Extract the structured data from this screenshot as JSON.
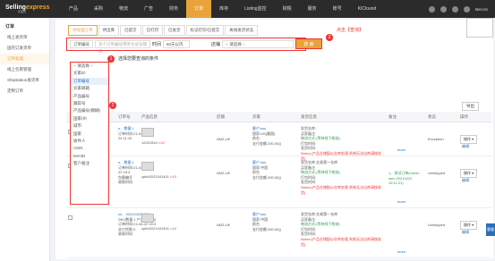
{
  "brand": {
    "name_a": "Selling",
    "name_b": "express",
    "sub": "赛盈网"
  },
  "nav": [
    "产品",
    "采购",
    "物流",
    "广告",
    "财务",
    "订单",
    "库存",
    "Listing监控",
    "财税",
    "服务",
    "账号",
    "KIClound"
  ],
  "nav_active": 5,
  "sidebar": {
    "section": "订单",
    "items": [
      "线上发货单",
      "国内订发货单",
      "订单处理",
      "线上包裹管理",
      "Shipstation发货单",
      "定制订单"
    ],
    "active": 2
  },
  "tabs": [
    "待处理订单",
    "待出库",
    "已提交",
    "已打印",
    "已发货",
    "标记打印/已提交",
    "离线发货状态"
  ],
  "filter": {
    "type": "订单编号",
    "placeholder": "多个订单编号用英文逗号隔开",
    "time_label": "时间",
    "time_value": "60天以内",
    "sort_label": "店铺",
    "store_placeholder": "-- 请选择 --"
  },
  "search_button": "搜 索",
  "badge1": "1",
  "badge2": "2",
  "badge3": "3",
  "note_query": "点击【查询】",
  "note_select": "选择您要查询的条件",
  "dropdown": [
    "-- 请选择 --",
    "买家ID",
    "订单编号",
    "买家邮箱",
    "产品编号",
    "跟踪号",
    "产品编号(模糊)",
    "国家/州",
    "城市",
    "国家",
    "收件人",
    "ASIN",
    "ItemID",
    "客户备注"
  ],
  "dropdown_active": 2,
  "export": "导出",
  "table_headers": [
    "订单号",
    "产品信息",
    "店铺",
    "买家",
    "发货信息",
    "备注",
    "状态",
    "操作"
  ],
  "rows": [
    {
      "order": [
        "s... 数量 1",
        "订单时间:21-04",
        "24 11:10"
      ],
      "sku": "12221544",
      "qty": "×10",
      "store": "AMZ-UK",
      "buyer": [
        "客户:sss",
        "国家:US(美国)",
        "前台",
        "支付金额:200.00()"
      ],
      "ship": [
        "发货仓库:",
        "买家备注:",
        "物流方式:(等待线下物流)",
        "打包时间:",
        "发货时间:"
      ],
      "notes": "Notes:(产品仓储配以仓库处理,系统无法出库请按发货)",
      "remark": "",
      "status": "Exception",
      "op": "操作"
    },
    {
      "order": [
        "s... 数量 1",
        "订单时间:21-04-",
        "22 15:3",
        "包裹编号",
        "收款时间"
      ],
      "sku": "cpbh2021041401",
      "qty": "×10",
      "store": "AMZ-UK",
      "buyer": [
        "客户:sss",
        "国家:中国",
        "前台",
        "支付金额:200.00()"
      ],
      "ship": [
        "发货仓库:交易第一仓库",
        "买家备注:",
        "物流方式:(等待线下物流)",
        "打包时间:",
        "发货时间:"
      ],
      "notes": "Notes:(产品仓储配以仓库处理,系统无法出库请按发货)",
      "remark": "1、测试订单(menlo wen 2021/4/22 15:11:21)",
      "status": "Unshipped",
      "op": "操作"
    },
    {
      "order": [
        "cs... 202104220001",
        "SKU数量 1 产品数量:10",
        "订单时间:21-04-22 15:3",
        "支付完款:0",
        "收款时间"
      ],
      "sku": "cpbh2021041401",
      "qty": "×10",
      "store": "AMZ-UK",
      "buyer": [
        "客户:sss",
        "国家:中国",
        "前台",
        "支付金额:200.00()"
      ],
      "ship": [
        "发货仓库:交易第一仓库",
        "买家备注:",
        "物流方式:(等待线下物流)",
        "打包时间:",
        "发货时间:"
      ],
      "notes": "Notes:(产品仓储配以仓库处理,系统无法出库请按发货)",
      "remark": "",
      "status": "Unshipped",
      "op": "操作"
    }
  ],
  "more": "more",
  "edit": "编辑",
  "float_label": "客服"
}
